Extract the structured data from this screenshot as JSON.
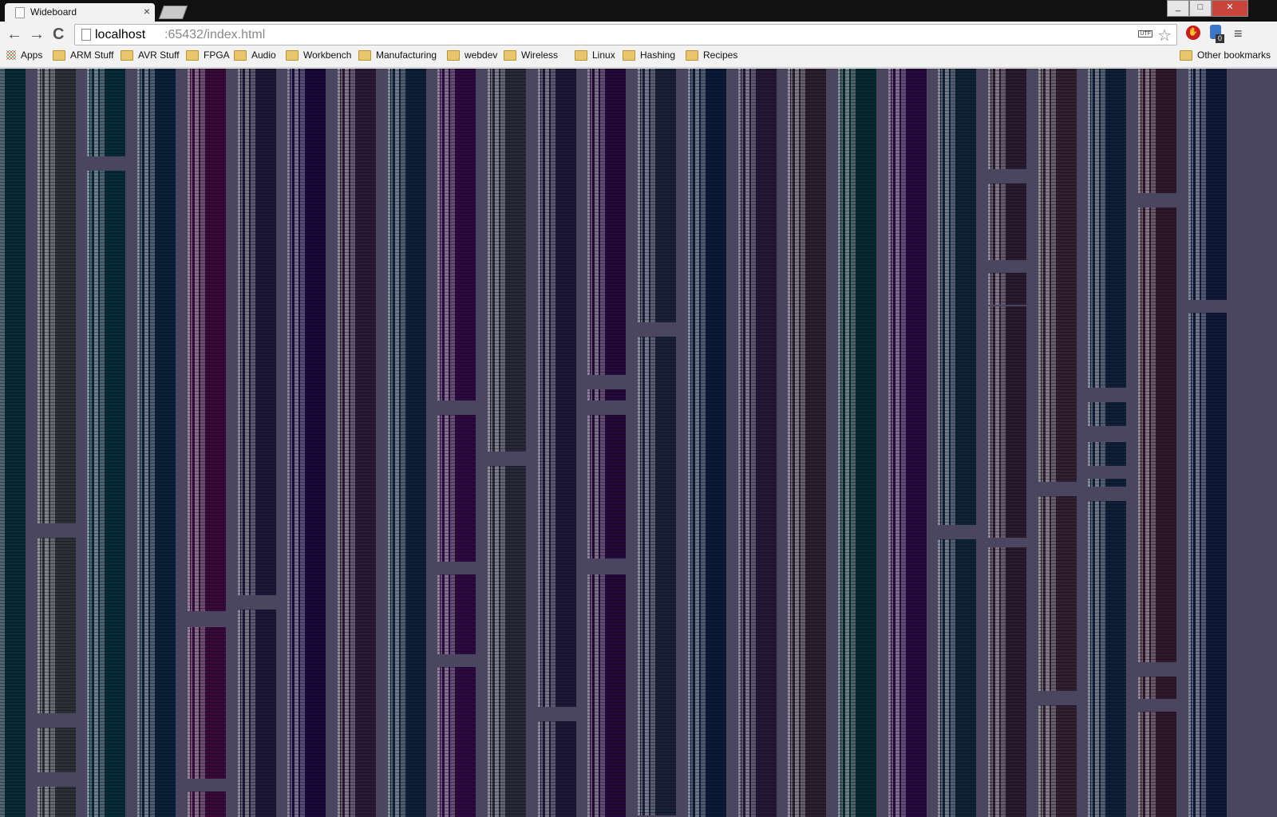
{
  "window": {
    "tab_title": "Wideboard",
    "tab_close": "×",
    "minimize": "_",
    "maximize": "□",
    "close": "✕"
  },
  "toolbar": {
    "back": "←",
    "forward": "→",
    "reload": "C",
    "url_host": "localhost",
    "url_rest": ":65432/index.html",
    "encoding_badge": "UTF",
    "star": "☆",
    "ext_badge": "0",
    "menu": "≡"
  },
  "bookmarks": {
    "apps": "Apps",
    "items": [
      "ARM Stuff",
      "AVR Stuff",
      "FPGA",
      "Audio",
      "Workbench",
      "Manufacturing",
      "webdev",
      "Wireless",
      "Linux",
      "Hashing",
      "Recipes"
    ],
    "other": "Other bookmarks"
  },
  "colors": {
    "board_background": "#4a4660",
    "column_palette": [
      "#0b2a38",
      "#2e3038",
      "#072a38",
      "#0a2038",
      "#380a3a",
      "#1e1838",
      "#180a3a",
      "#2a1a38",
      "#0e2038",
      "#2c0a40",
      "#282838",
      "#1e1838",
      "#240a3a",
      "#1a2038",
      "#0c1a38",
      "#241838",
      "#2a2030",
      "#062a30",
      "#260a40",
      "#102238",
      "#2a1c30",
      "#302030",
      "#102038",
      "#30182c",
      "#0e1a38"
    ]
  }
}
